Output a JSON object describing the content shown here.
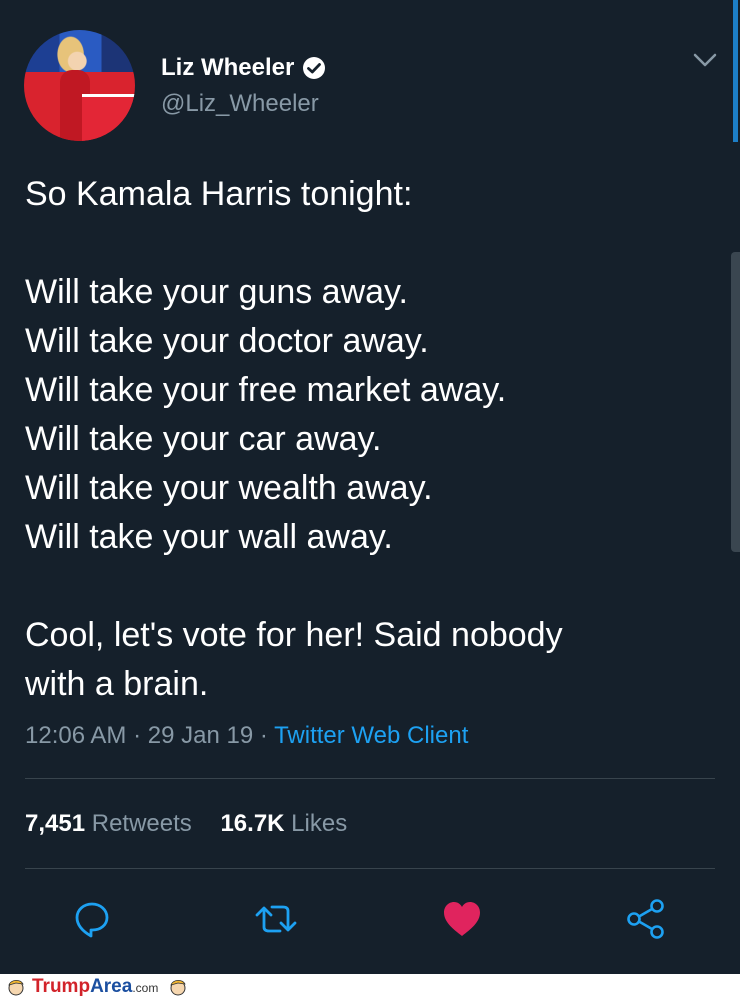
{
  "tweet": {
    "author_name": "Liz Wheeler",
    "handle": "@Liz_Wheeler",
    "lines": [
      "So Kamala Harris tonight:",
      "",
      "Will take your guns away.",
      "Will take your doctor away.",
      "Will take your free market away.",
      "Will take your car away.",
      "Will take your wealth away.",
      "Will take your wall away.",
      "",
      "Cool, let's vote for her! Said nobody",
      "with a brain."
    ],
    "time": "12:06 AM",
    "date": "29 Jan 19",
    "client": "Twitter Web Client",
    "separator": "·"
  },
  "stats": {
    "retweets_count": "7,451",
    "retweets_label": "Retweets",
    "likes_count": "16.7K",
    "likes_label": "Likes"
  },
  "actions": {
    "reply_icon": "reply-icon",
    "retweet_icon": "retweet-icon",
    "like_icon": "heart-icon",
    "share_icon": "share-icon"
  },
  "watermark": {
    "brand_part1": "Trump",
    "brand_part2": "Area",
    "brand_suffix": ".com"
  },
  "colors": {
    "background": "#15202b",
    "accent": "#1da1f2",
    "like": "#e0245e",
    "muted": "#8899a6"
  }
}
